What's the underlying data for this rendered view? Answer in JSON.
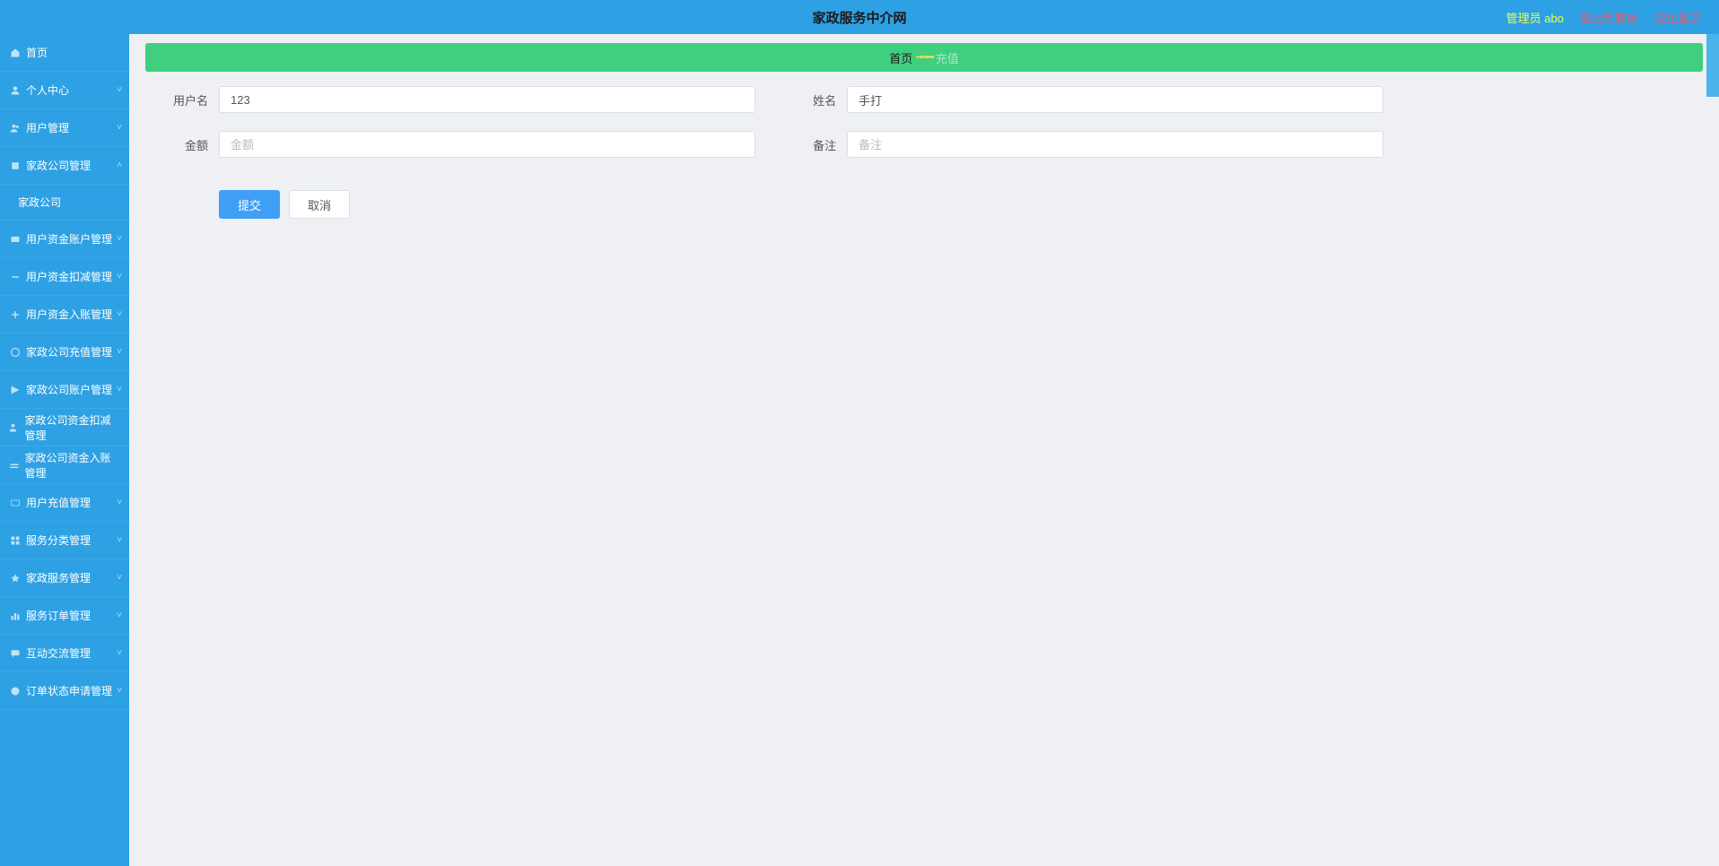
{
  "header": {
    "title": "家政服务中介网",
    "admin_label": "管理员 abo",
    "to_front_label": "退出到前台",
    "logout_label": "退出登录"
  },
  "sidebar": {
    "items": [
      {
        "icon": "home",
        "label": "首页",
        "chev": ""
      },
      {
        "icon": "user",
        "label": "个人中心",
        "chev": "˅"
      },
      {
        "icon": "users",
        "label": "用户管理",
        "chev": "˅"
      },
      {
        "icon": "company",
        "label": "家政公司管理",
        "chev": "˄",
        "expanded": true,
        "children": [
          {
            "label": "家政公司"
          }
        ]
      },
      {
        "icon": "wallet",
        "label": "用户资金账户管理",
        "chev": "˅"
      },
      {
        "icon": "minus",
        "label": "用户资金扣减管理",
        "chev": "˅"
      },
      {
        "icon": "plus",
        "label": "用户资金入账管理",
        "chev": "˅"
      },
      {
        "icon": "recharge",
        "label": "家政公司充值管理",
        "chev": "˅"
      },
      {
        "icon": "account",
        "label": "家政公司账户管理",
        "chev": "˅"
      },
      {
        "icon": "userminus",
        "label": "家政公司资金扣减管理",
        "chev": ""
      },
      {
        "icon": "userplus",
        "label": "家政公司资金入账管理",
        "chev": ""
      },
      {
        "icon": "card",
        "label": "用户充值管理",
        "chev": "˅"
      },
      {
        "icon": "grid",
        "label": "服务分类管理",
        "chev": "˅"
      },
      {
        "icon": "service",
        "label": "家政服务管理",
        "chev": "˅"
      },
      {
        "icon": "chart",
        "label": "服务订单管理",
        "chev": "˅"
      },
      {
        "icon": "chat",
        "label": "互动交流管理",
        "chev": "˅"
      },
      {
        "icon": "status",
        "label": "订单状态申请管理",
        "chev": "˅"
      }
    ]
  },
  "breadcrumb": {
    "home": "首页",
    "sep": "╼╼╼",
    "current": "充值"
  },
  "form": {
    "username_label": "用户名",
    "username_value": "123",
    "name_label": "姓名",
    "name_value": "手打",
    "amount_label": "金额",
    "amount_placeholder": "金额",
    "amount_value": "",
    "remark_label": "备注",
    "remark_placeholder": "备注",
    "remark_value": "",
    "submit_label": "提交",
    "cancel_label": "取消"
  }
}
